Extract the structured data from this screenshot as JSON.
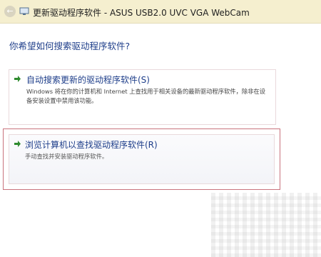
{
  "window": {
    "title": "更新驱动程序软件 - ASUS USB2.0 UVC VGA WebCam"
  },
  "main": {
    "question": "你希望如何搜索驱动程序软件?"
  },
  "options": [
    {
      "title": "自动搜索更新的驱动程序软件(S)",
      "description": "Windows 将在你的计算机和 Internet 上查找用于相关设备的最新驱动程序软件，除非在设备安装设置中禁用该功能。"
    },
    {
      "title": "浏览计算机以查找驱动程序软件(R)",
      "description": "手动查找并安装驱动程序软件。"
    }
  ],
  "colors": {
    "titlebar": "#f5efcf",
    "link_blue": "#1e3e8a",
    "arrow_green": "#2e8b2e",
    "selected_border": "#c9737d"
  },
  "icons": {
    "back": "back-arrow-icon",
    "device": "webcam-device-icon",
    "option_arrow": "green-arrow-icon"
  }
}
